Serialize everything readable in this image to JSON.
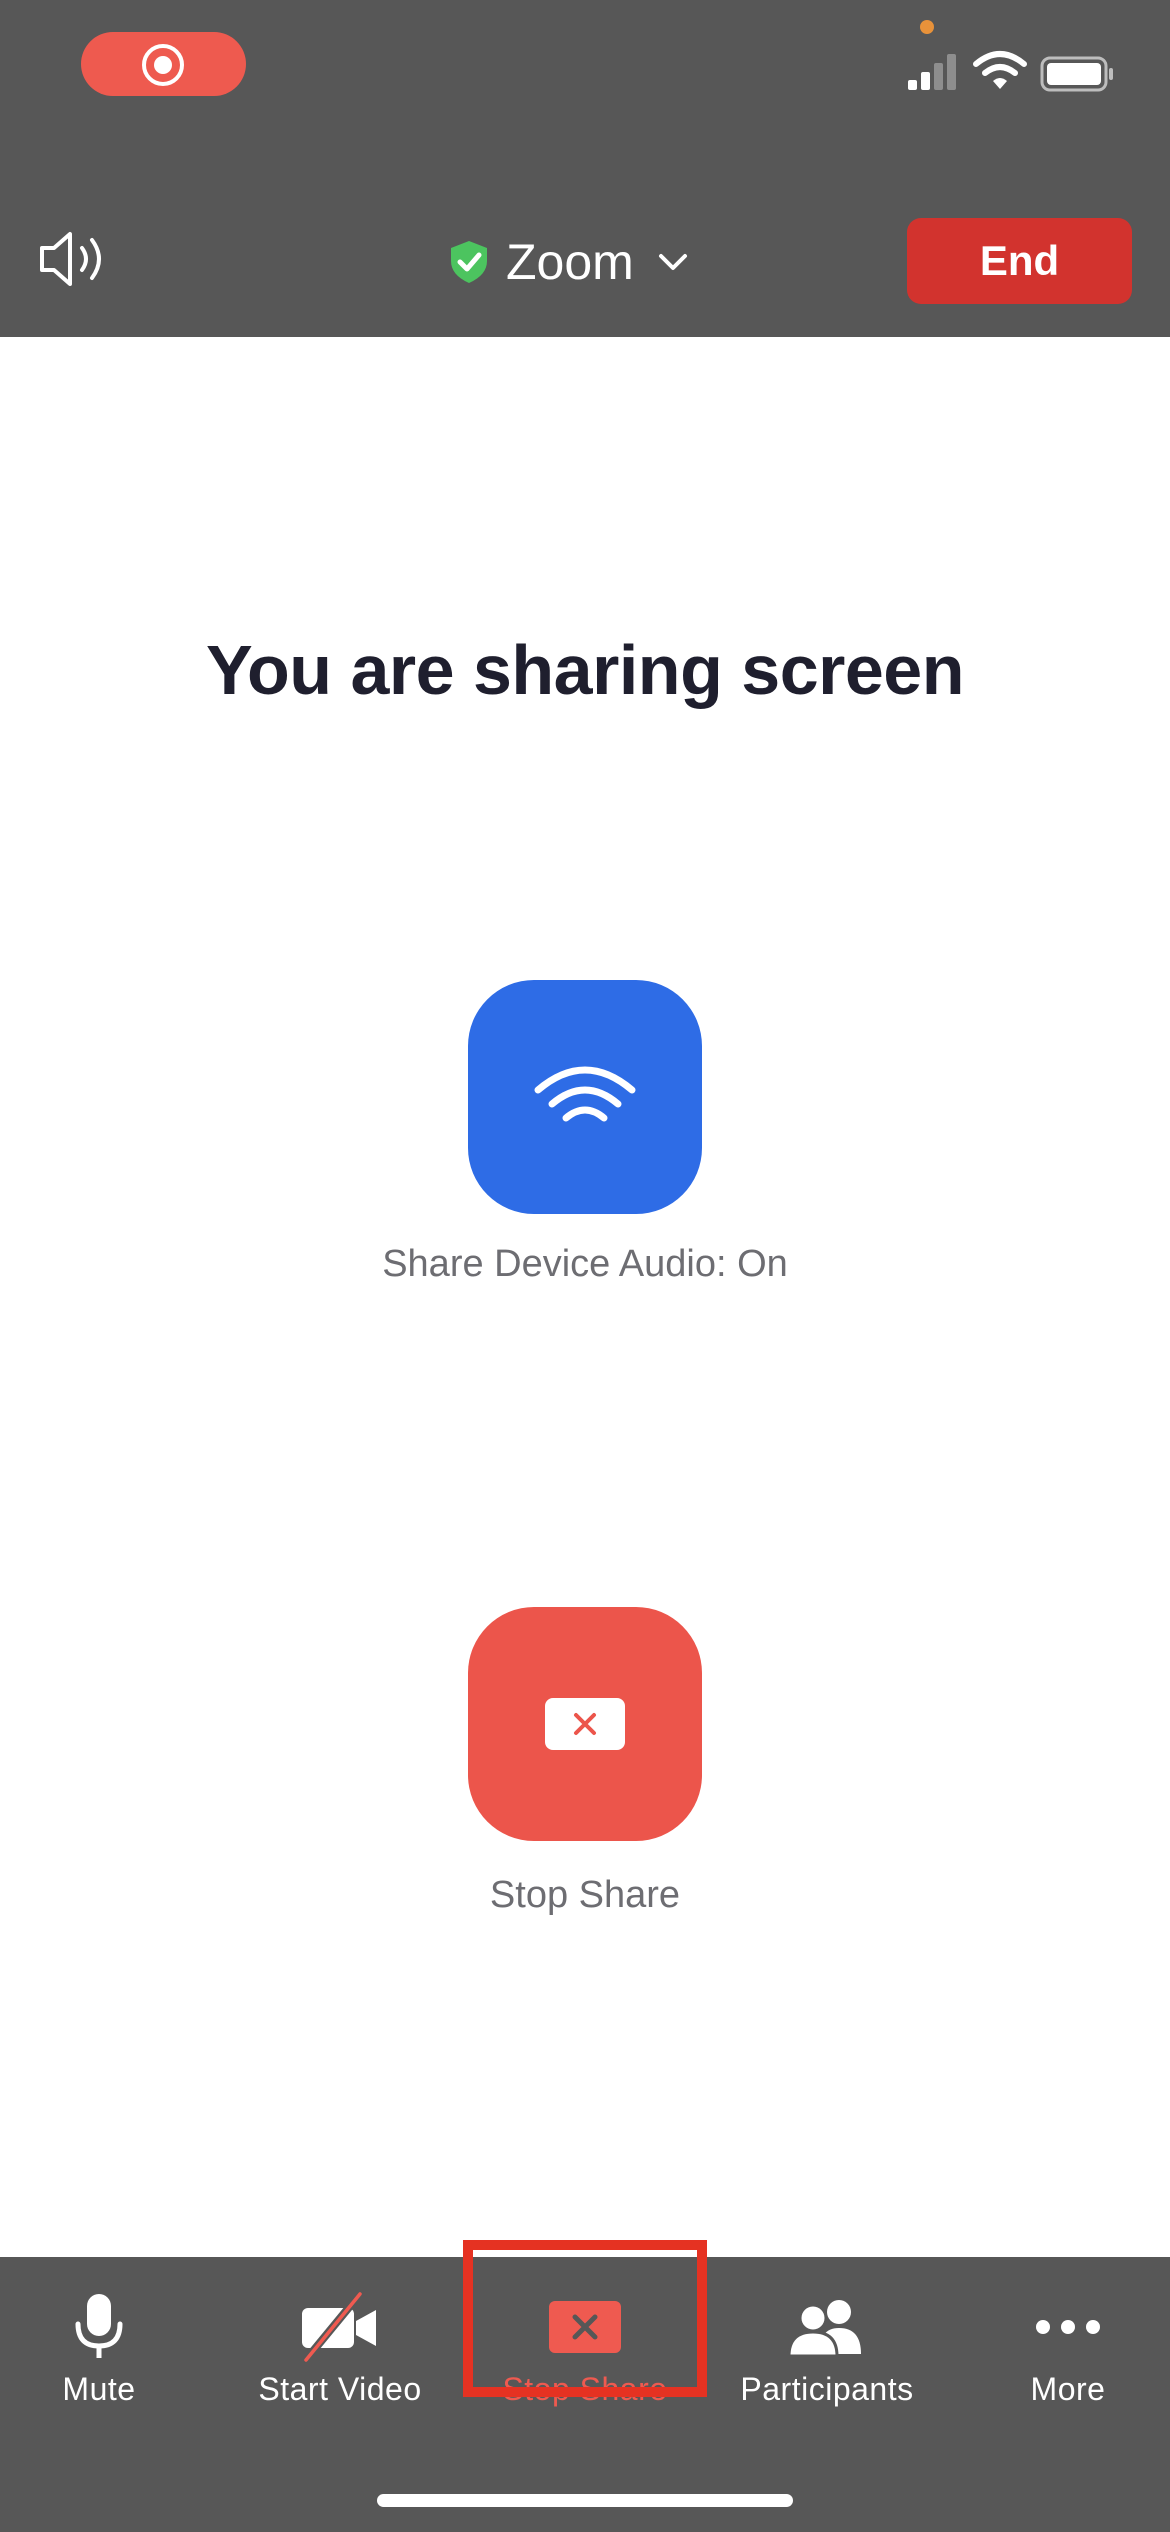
{
  "status_bar": {
    "recording_icon": "record-icon",
    "signal_icon": "cellular-signal-icon",
    "wifi_icon": "wifi-icon",
    "battery_icon": "battery-icon"
  },
  "header": {
    "speaker_icon": "speaker-icon",
    "title": "Zoom",
    "shield_icon": "shield-check-icon",
    "chevron_icon": "chevron-down-icon",
    "end_label": "End"
  },
  "main": {
    "heading": "You are sharing screen",
    "audio_button_label": "Share Device Audio: On",
    "stop_share_label": "Stop Share"
  },
  "toolbar": {
    "items": [
      {
        "label": "Mute",
        "icon": "microphone-icon"
      },
      {
        "label": "Start Video",
        "icon": "video-off-icon"
      },
      {
        "label": "Stop Share",
        "icon": "stop-share-icon"
      },
      {
        "label": "Participants",
        "icon": "participants-icon"
      },
      {
        "label": "More",
        "icon": "more-dots-icon"
      }
    ]
  },
  "colors": {
    "header_bg": "#575757",
    "end_button": "#d2332e",
    "audio_button": "#2e6ce6",
    "stop_share_button": "#ec554b",
    "highlight": "#e53222",
    "secure_green": "#4cc45f"
  }
}
